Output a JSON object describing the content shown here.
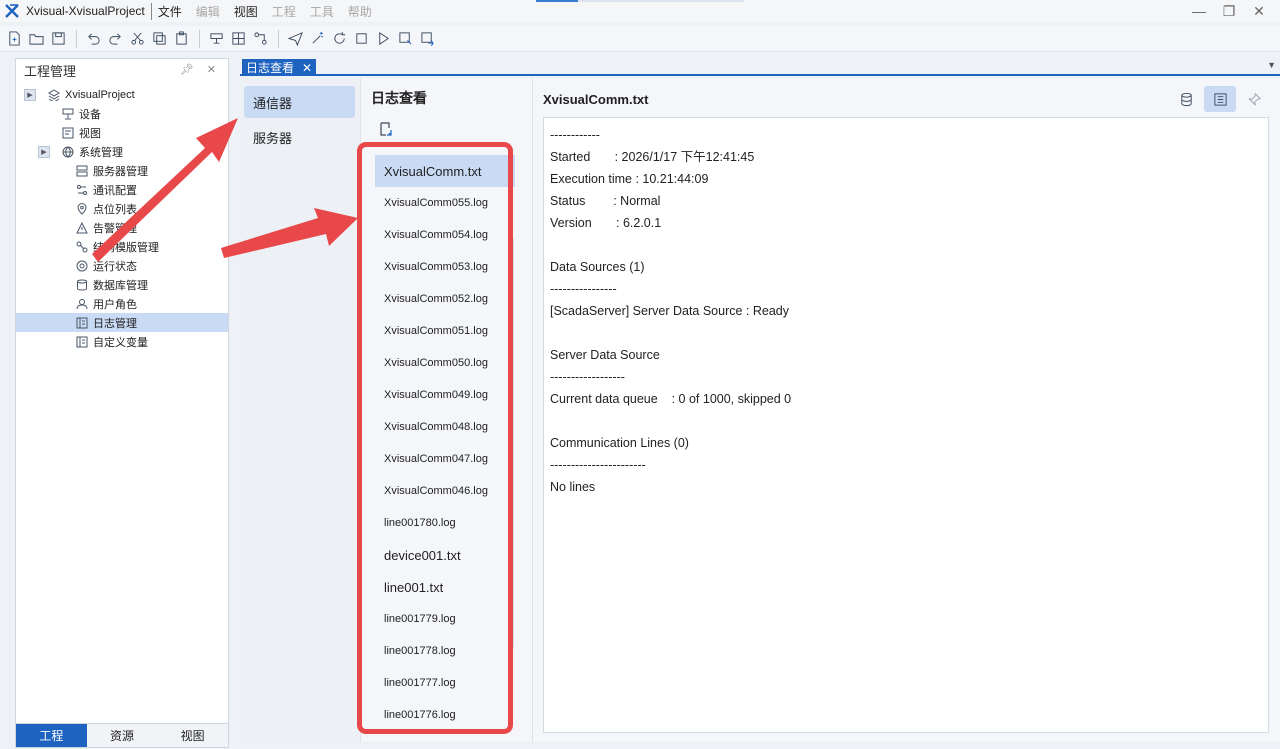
{
  "window": {
    "title": "Xvisual-XvisualProject",
    "menu": [
      {
        "label": "文件",
        "enabled": true
      },
      {
        "label": "编辑",
        "enabled": false
      },
      {
        "label": "视图",
        "enabled": true
      },
      {
        "label": "工程",
        "enabled": false
      },
      {
        "label": "工具",
        "enabled": false
      },
      {
        "label": "帮助",
        "enabled": false
      }
    ]
  },
  "left_panel": {
    "title": "工程管理",
    "tree": [
      {
        "label": "XvisualProject",
        "level": 0,
        "expander": true,
        "icon": "layers-icon"
      },
      {
        "label": "设备",
        "level": 1,
        "icon": "device-icon"
      },
      {
        "label": "视图",
        "level": 1,
        "icon": "view-icon"
      },
      {
        "label": "系统管理",
        "level": 1,
        "expander": true,
        "icon": "globe-icon"
      },
      {
        "label": "服务器管理",
        "level": 2,
        "icon": "server-icon"
      },
      {
        "label": "通讯配置",
        "level": 2,
        "icon": "comm-config-icon"
      },
      {
        "label": "点位列表",
        "level": 2,
        "icon": "location-pin-icon"
      },
      {
        "label": "告警管理",
        "level": 2,
        "icon": "alarm-triangle-icon"
      },
      {
        "label": "结构模版管理",
        "level": 2,
        "icon": "structure-icon"
      },
      {
        "label": "运行状态",
        "level": 2,
        "icon": "run-status-icon"
      },
      {
        "label": "数据库管理",
        "level": 2,
        "icon": "database-icon"
      },
      {
        "label": "用户角色",
        "level": 2,
        "icon": "user-role-icon"
      },
      {
        "label": "日志管理",
        "level": 2,
        "icon": "log-icon",
        "selected": true
      },
      {
        "label": "自定义变量",
        "level": 2,
        "icon": "custom-var-icon"
      }
    ],
    "tabs": [
      {
        "label": "工程",
        "active": true
      },
      {
        "label": "资源",
        "active": false
      },
      {
        "label": "视图",
        "active": false
      }
    ]
  },
  "doc_tab": {
    "label": "日志查看"
  },
  "side_nav": [
    {
      "label": "通信器",
      "active": true
    },
    {
      "label": "服务器",
      "active": false
    }
  ],
  "log_list": {
    "title": "日志查看",
    "files": [
      {
        "name": "XvisualComm.txt",
        "active": true,
        "big": true
      },
      {
        "name": "XvisualComm055.log"
      },
      {
        "name": "XvisualComm054.log"
      },
      {
        "name": "XvisualComm053.log"
      },
      {
        "name": "XvisualComm052.log"
      },
      {
        "name": "XvisualComm051.log"
      },
      {
        "name": "XvisualComm050.log"
      },
      {
        "name": "XvisualComm049.log"
      },
      {
        "name": "XvisualComm048.log"
      },
      {
        "name": "XvisualComm047.log"
      },
      {
        "name": "XvisualComm046.log"
      },
      {
        "name": "line001780.log"
      },
      {
        "name": "device001.txt",
        "big": true
      },
      {
        "name": "line001.txt",
        "big": true
      },
      {
        "name": "line001779.log"
      },
      {
        "name": "line001778.log"
      },
      {
        "name": "line001777.log"
      },
      {
        "name": "line001776.log"
      }
    ]
  },
  "detail": {
    "title": "XvisualComm.txt",
    "lines": [
      "------------",
      "Started       : 2026/1/17 下午12:41:45",
      "Execution time : 10.21:44:09",
      "Status        : Normal",
      "Version       : 6.2.0.1",
      "",
      "Data Sources (1)",
      "----------------",
      "[ScadaServer] Server Data Source : Ready",
      "",
      "Server Data Source",
      "------------------",
      "Current data queue    : 0 of 1000, skipped 0",
      "",
      "Communication Lines (0)",
      "-----------------------",
      "No lines"
    ]
  },
  "colors": {
    "accent": "#1f63c0",
    "selection": "#c9daf5",
    "annotation": "#e8484a"
  }
}
